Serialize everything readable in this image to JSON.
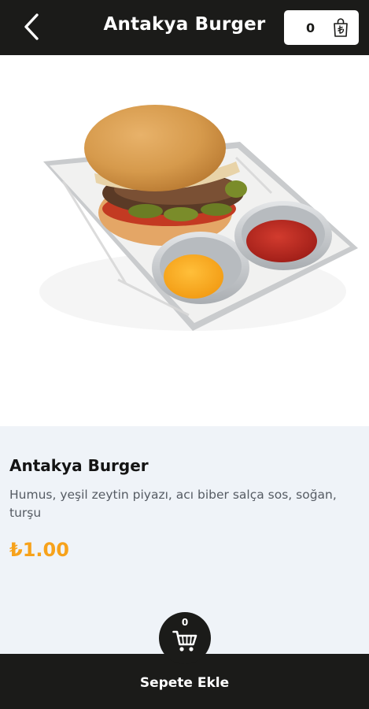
{
  "header": {
    "title": "Antakya Burger",
    "cart_count": "0"
  },
  "product": {
    "image_alt": "burger-tray-photo",
    "name": "Antakya Burger",
    "description": "Humus, yeşil zeytin piyazı, acı biber salça sos, soğan, turşu",
    "price": "₺1.00"
  },
  "footer": {
    "cart_count": "0",
    "add_to_cart_label": "Sepete Ekle"
  },
  "colors": {
    "dark": "#1b1b19",
    "accent_price": "#f7a21b",
    "panel_bg": "#eff3f8"
  },
  "icons": {
    "back": "chevron-left-icon",
    "bag": "shopping-bag-lira-icon",
    "cart": "shopping-cart-icon"
  }
}
